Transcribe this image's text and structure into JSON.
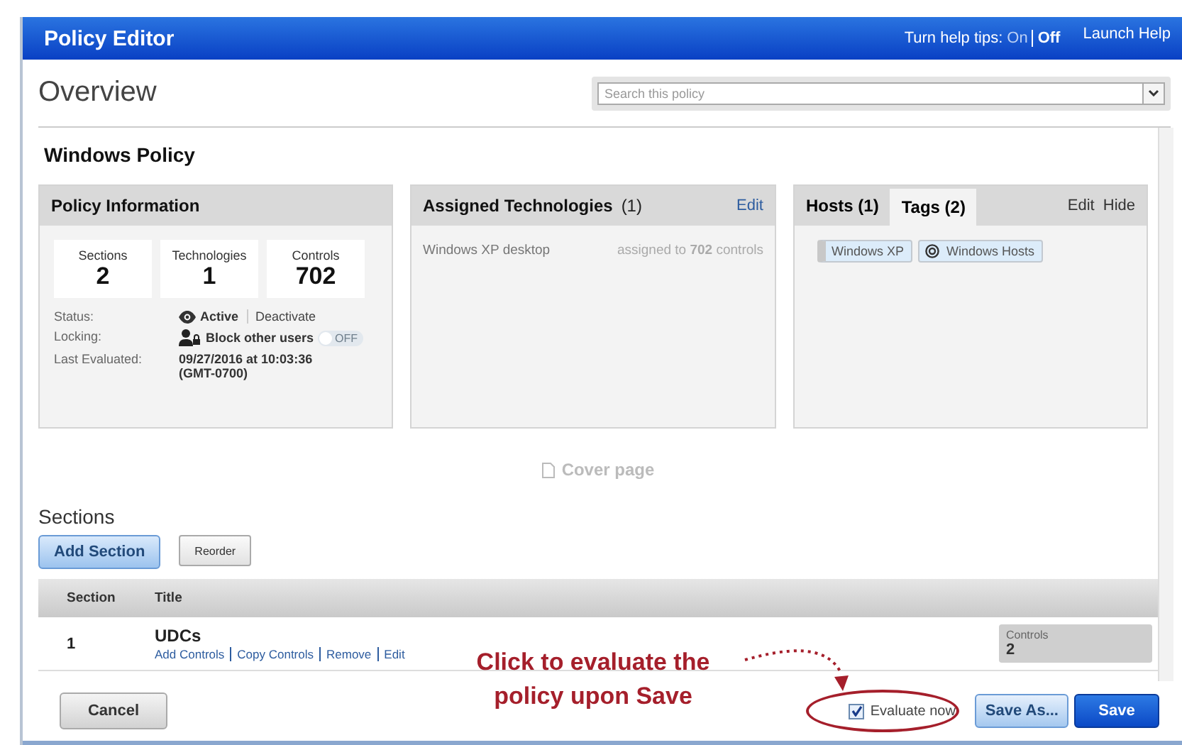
{
  "header": {
    "title": "Policy Editor",
    "help_tips": {
      "label": "Turn help tips:",
      "options": [
        {
          "label": "On",
          "selected": false
        },
        {
          "label": "Off",
          "selected": true
        }
      ]
    },
    "launch_help": "Launch Help"
  },
  "overview": {
    "title": "Overview",
    "search": {
      "placeholder": "Search this policy"
    }
  },
  "policy": {
    "title": "Windows Policy"
  },
  "policy_info": {
    "title": "Policy Information",
    "stats": [
      {
        "label": "Sections",
        "value": "2"
      },
      {
        "label": "Technologies",
        "value": "1"
      },
      {
        "label": "Controls",
        "value": "702"
      }
    ],
    "status": {
      "label": "Status:",
      "value": "Active",
      "action": "Deactivate"
    },
    "locking": {
      "label": "Locking:",
      "value": "Block other users",
      "toggle": {
        "label": "OFF",
        "on": false
      }
    },
    "last_evaluated": {
      "label": "Last Evaluated:",
      "value": "09/27/2016 at 10:03:36 (GMT-0700)"
    }
  },
  "assigned_technologies": {
    "title": "Assigned Technologies",
    "count": "(1)",
    "edit": "Edit",
    "items": [
      {
        "name": "Windows XP desktop",
        "assignment": "assigned to **702** controls"
      }
    ]
  },
  "targets": {
    "tabs": [
      {
        "label": "Hosts (1)",
        "selected": false
      },
      {
        "label": "Tags (2)",
        "selected": true
      }
    ],
    "actions": [
      "Edit",
      "Hide"
    ],
    "tags": [
      {
        "label": "Windows XP",
        "kind": "static"
      },
      {
        "label": "Windows Hosts",
        "kind": "dynamic"
      }
    ]
  },
  "cover_page": {
    "label": "Cover page",
    "disabled": true
  },
  "sections": {
    "heading": "Sections",
    "add_button": "Add Section",
    "reorder_button": "Reorder",
    "columns": [
      "Section",
      "Title"
    ],
    "rows": [
      {
        "section": "1",
        "title": "UDCs",
        "actions": [
          "Add Controls",
          "Copy Controls",
          "Remove",
          "Edit"
        ],
        "controls_label": "Controls",
        "controls": "2"
      }
    ]
  },
  "footer": {
    "cancel": "Cancel",
    "evaluate_now": {
      "label": "Evaluate now",
      "checked": true
    },
    "save_as": "Save As...",
    "save": "Save"
  },
  "annotation": {
    "text": "Click to evaluate the policy upon Save"
  }
}
